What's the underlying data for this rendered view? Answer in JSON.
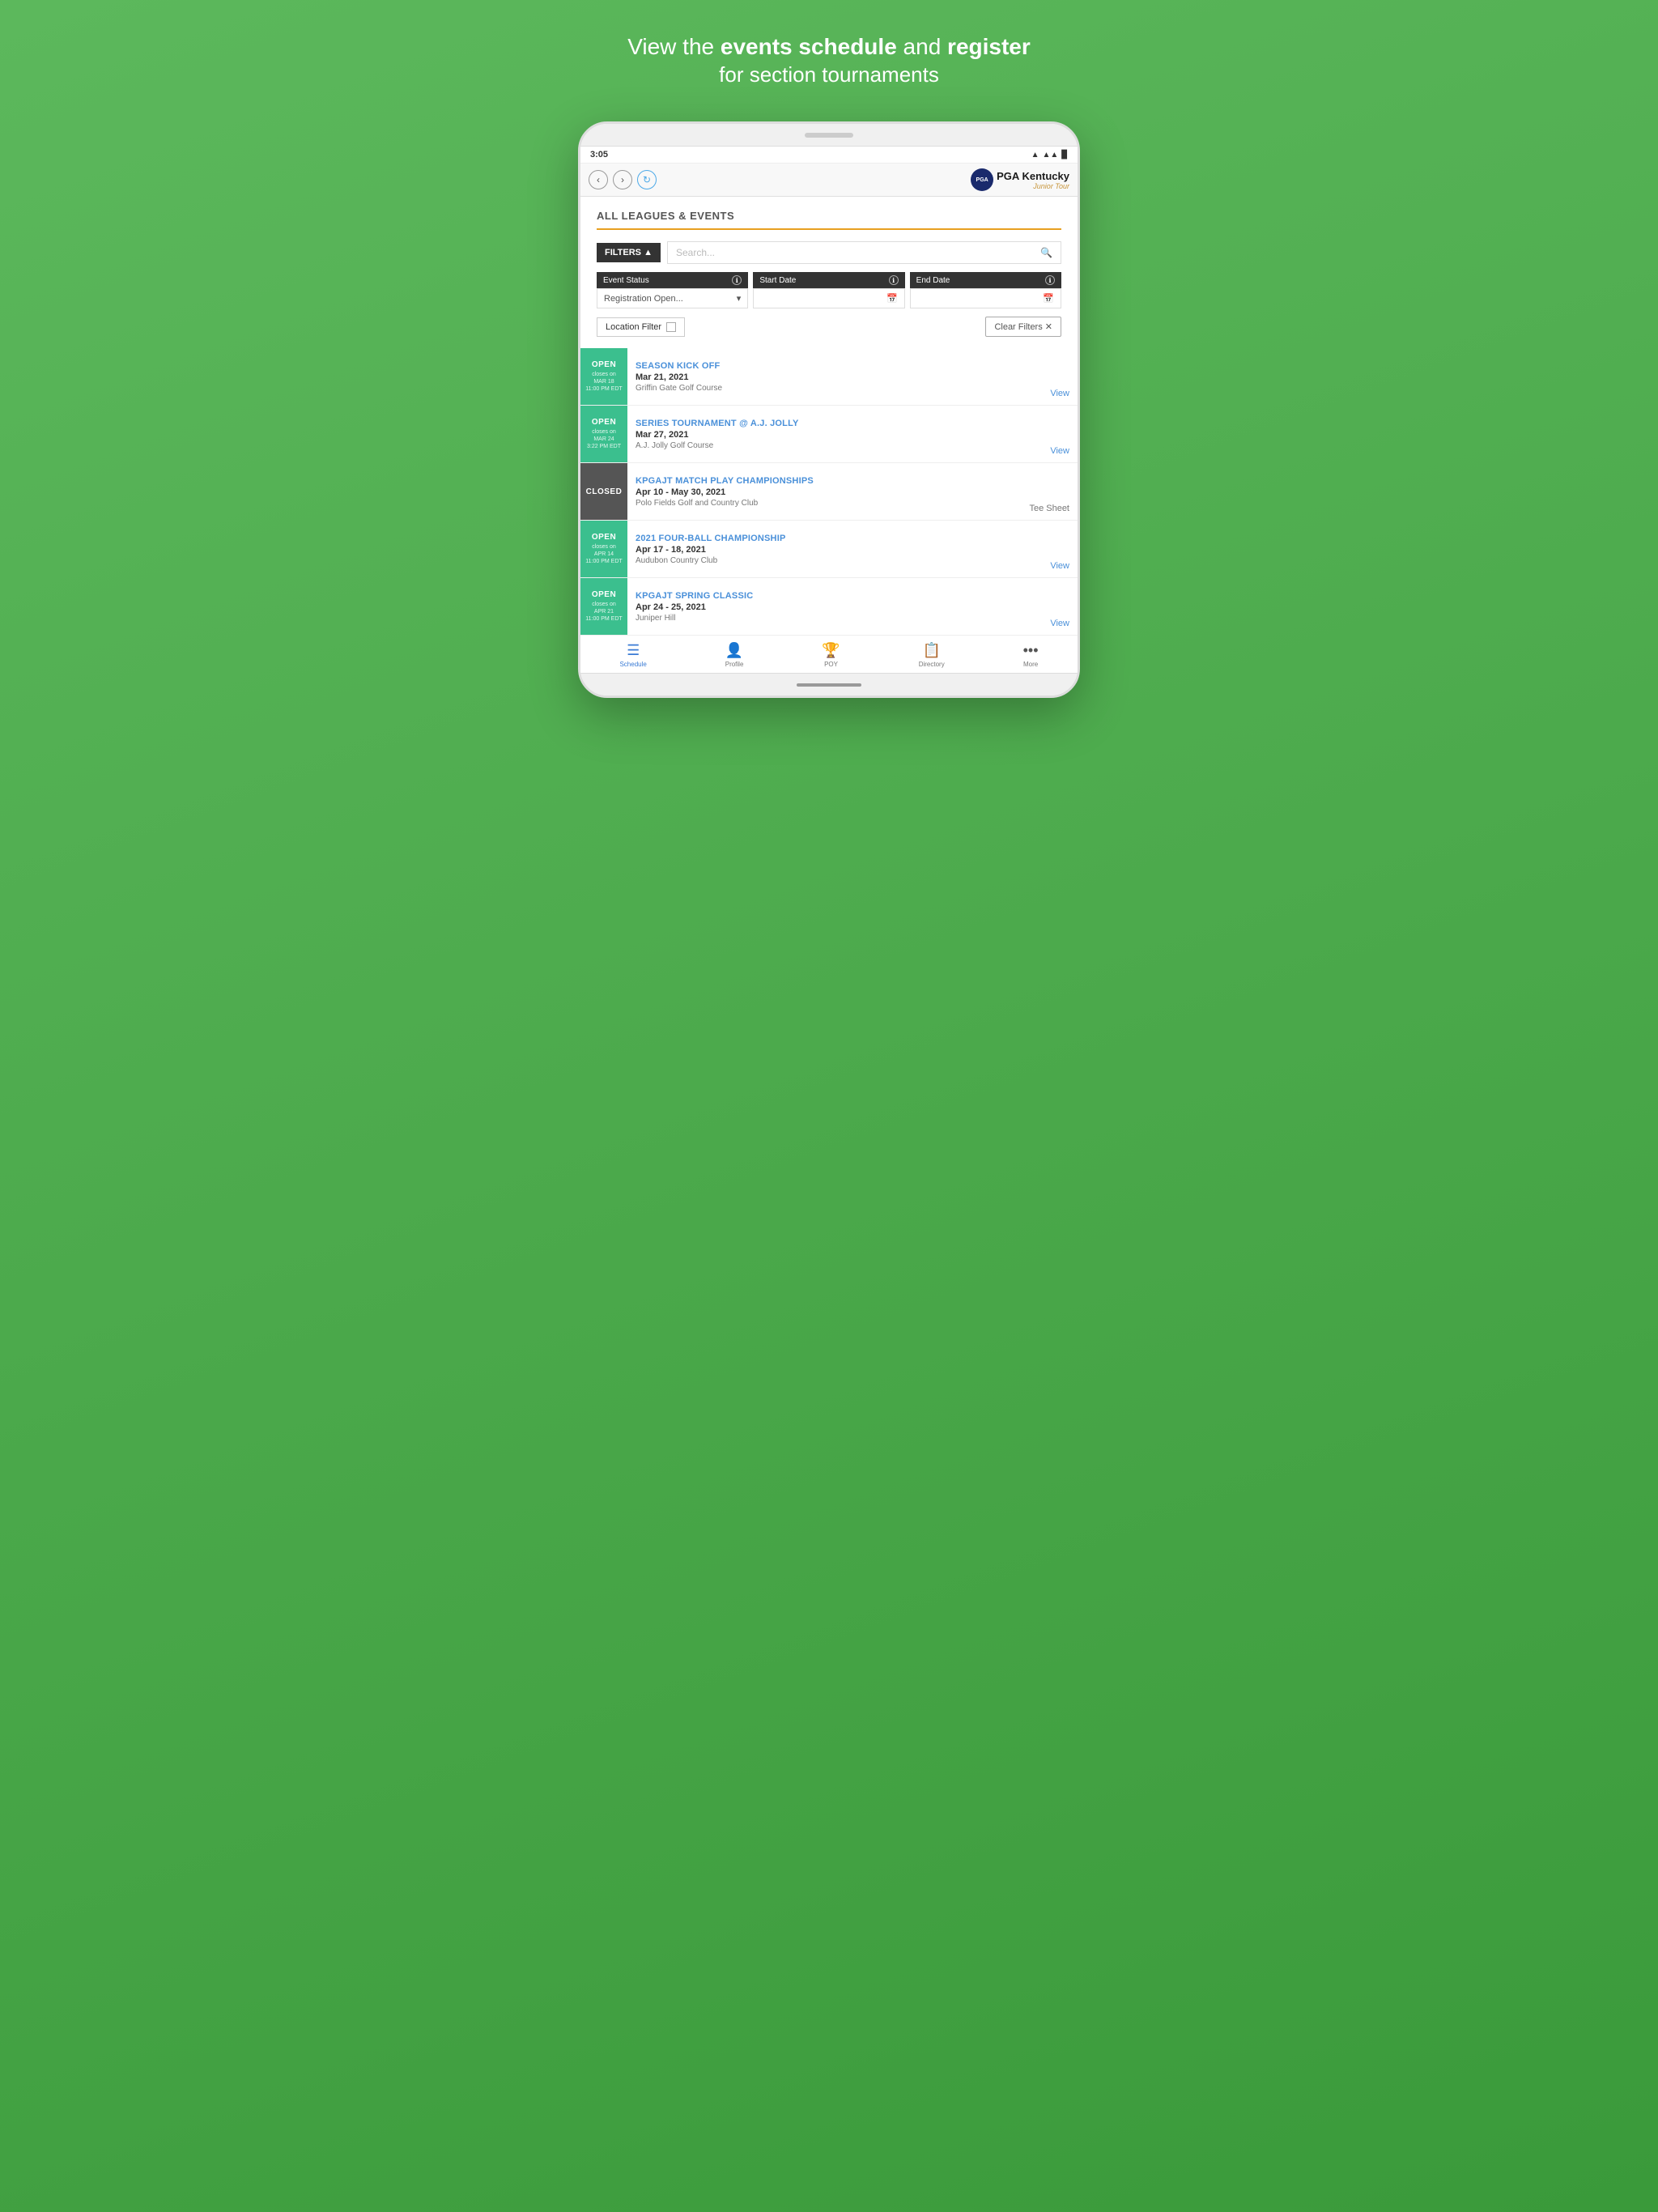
{
  "headline": {
    "line1_plain": "View the ",
    "line1_bold1": "events schedule",
    "line1_plain2": " and ",
    "line1_bold2": "register",
    "line2": "for section tournaments"
  },
  "status_bar": {
    "time": "3:05",
    "signals": "▲◀ 2.1 ▉"
  },
  "browser": {
    "back_label": "‹",
    "forward_label": "›",
    "refresh_label": "↻",
    "pga_badge": "PGA",
    "pga_name": "PGA",
    "pga_state": "Kentucky",
    "pga_sub": "Junior Tour"
  },
  "page": {
    "title": "ALL LEAGUES & EVENTS"
  },
  "filters": {
    "button_label": "FILTERS ▲",
    "search_placeholder": "Search...",
    "event_status_label": "Event Status",
    "start_date_label": "Start Date",
    "end_date_label": "End Date",
    "event_status_value": "Registration Open...",
    "location_filter_label": "Location Filter",
    "clear_filters_label": "Clear Filters ✕"
  },
  "events": [
    {
      "status": "open",
      "badge": "OPEN",
      "closes_line1": "closes on",
      "closes_line2": "MAR 18",
      "closes_line3": "11:00 PM EDT",
      "name": "SEASON KICK OFF",
      "date": "Mar 21, 2021",
      "venue": "Griffin Gate Golf Course",
      "action": "View",
      "action_type": "view"
    },
    {
      "status": "open",
      "badge": "OPEN",
      "closes_line1": "closes on",
      "closes_line2": "MAR 24",
      "closes_line3": "3:22 PM EDT",
      "name": "SERIES TOURNAMENT @ A.J. JOLLY",
      "date": "Mar 27, 2021",
      "venue": "A.J. Jolly Golf Course",
      "action": "View",
      "action_type": "view"
    },
    {
      "status": "closed",
      "badge": "CLOSED",
      "closes_line1": "",
      "closes_line2": "",
      "closes_line3": "",
      "name": "KPGAJT MATCH PLAY CHAMPIONSHIPS",
      "date": "Apr 10 - May 30, 2021",
      "venue": "Polo Fields Golf and Country Club",
      "action": "Tee Sheet",
      "action_type": "teesheet"
    },
    {
      "status": "open",
      "badge": "OPEN",
      "closes_line1": "closes on",
      "closes_line2": "APR 14",
      "closes_line3": "11:00 PM EDT",
      "name": "2021 FOUR-BALL CHAMPIONSHIP",
      "date": "Apr 17 - 18, 2021",
      "venue": "Audubon Country Club",
      "action": "View",
      "action_type": "view"
    },
    {
      "status": "open",
      "badge": "OPEN",
      "closes_line1": "closes on",
      "closes_line2": "APR 21",
      "closes_line3": "11:00 PM EDT",
      "name": "KPGAJT SPRING CLASSIC",
      "date": "Apr 24 - 25, 2021",
      "venue": "Juniper Hill",
      "action": "View",
      "action_type": "view"
    }
  ],
  "bottom_nav": [
    {
      "icon": "☰",
      "label": "Schedule",
      "active": true
    },
    {
      "icon": "👤",
      "label": "Profile",
      "active": false
    },
    {
      "icon": "🏆",
      "label": "POY",
      "active": false
    },
    {
      "icon": "📋",
      "label": "Directory",
      "active": false
    },
    {
      "icon": "•••",
      "label": "More",
      "active": false
    }
  ]
}
